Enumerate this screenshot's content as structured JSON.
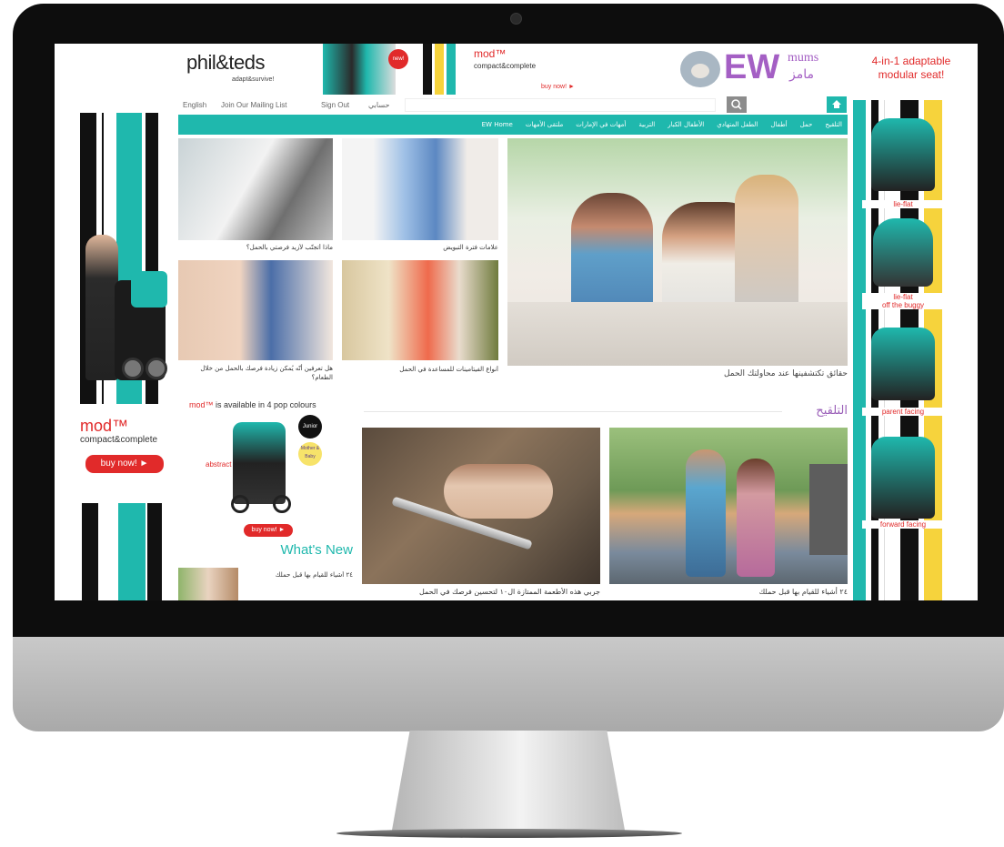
{
  "header": {
    "brand_name": "phil&teds",
    "brand_tagline": "adapt&survive!",
    "ad_new": "new!",
    "ad_mod": "mod™",
    "ad_mod_sub": "compact&complete",
    "ad_buy": "buy now! ►",
    "ew_mums": "mums",
    "ew_arabic": "مامز",
    "ew_logo": "EW",
    "adaptable_text": "4-in-1 adaptable\nmodular seat!"
  },
  "topbar": {
    "lang": "English",
    "mailing": "Join Our Mailing List",
    "signout": "Sign Out",
    "account": "حسابي",
    "search_placeholder": "",
    "home_icon": "home-icon",
    "search_icon": "search-icon"
  },
  "menu": {
    "items": [
      "التلقيح",
      "حمل",
      "أطفال",
      "الطفل المتهادي",
      "الأطفال الكبار",
      "التربية",
      "أمهات في الإمارات",
      "ملتقى الأمهات",
      "EW Home"
    ]
  },
  "articles": {
    "a1": "ماذا أتجنّب لأزيد فرصتي بالحمل؟",
    "a2": "علامات فترة التبويض",
    "a3": "هل تعرفين أنّه يُمكن زيادة فرصك بالحمل من خلال الطعام؟",
    "a4": "أنواع الفيتامينات للمساعدة في الحمل",
    "feature": "حقائق تكتشفينها عند محاولتك الحمل",
    "section": "التلقيح",
    "bottom_left": "جربي هذه الأطعمة الممتازة ال١٠ لتحسين فرصك في الحمل",
    "bottom_right": "٢٤ أشياء للقيام بها قبل حملك"
  },
  "promo": {
    "mod_text": "mod™",
    "pop_text": " is available in 4 pop colours",
    "abstract": "abstract",
    "buy": "buy now! ►",
    "junior": "Junior",
    "mother": "Mother & Baby"
  },
  "whatsnew": {
    "title": "What's New",
    "item": "٢٤ أشياء للقيام بها قبل حملك"
  },
  "left_ad": {
    "mod": "mod™",
    "sub": "compact&complete",
    "buy": "buy now! ►"
  },
  "right_ad": {
    "labels": [
      "lie-flat",
      "lie-flat\noff the buggy",
      "parent facing",
      "forward facing"
    ]
  },
  "colors": {
    "teal": "#1fb8ad",
    "red": "#e12a2a",
    "purple": "#9a5fb8",
    "yellow": "#f6d33c"
  }
}
